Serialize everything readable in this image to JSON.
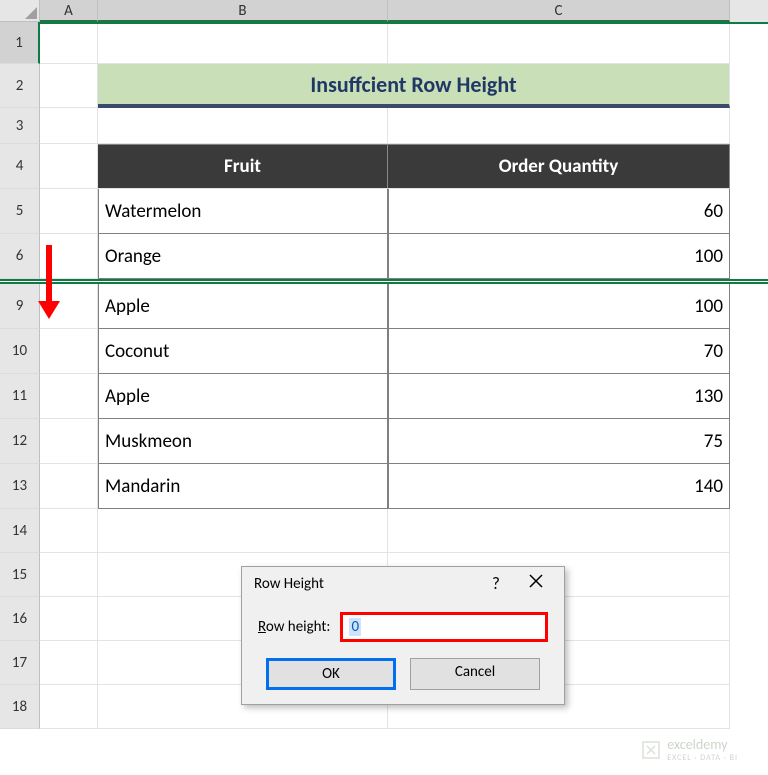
{
  "columns": {
    "A": "A",
    "B": "B",
    "C": "C"
  },
  "rows": {
    "r1": "1",
    "r2": "2",
    "r3": "3",
    "r4": "4",
    "r5": "5",
    "r6": "6",
    "r9": "9",
    "r10": "10",
    "r11": "11",
    "r12": "12",
    "r13": "13",
    "r14": "14",
    "r15": "15",
    "r16": "16",
    "r17": "17",
    "r18": "18"
  },
  "title": "Insuffcient Row Height",
  "headers": {
    "fruit": "Fruit",
    "qty": "Order Quantity"
  },
  "data": [
    {
      "fruit": "Watermelon",
      "qty": "60"
    },
    {
      "fruit": "Orange",
      "qty": "100"
    },
    {
      "fruit": "Apple",
      "qty": "100"
    },
    {
      "fruit": "Coconut",
      "qty": "70"
    },
    {
      "fruit": "Apple",
      "qty": "130"
    },
    {
      "fruit": "Muskmeon",
      "qty": "75"
    },
    {
      "fruit": "Mandarin",
      "qty": "140"
    }
  ],
  "dialog": {
    "title": "Row Height",
    "label_prefix": "R",
    "label_rest": "ow height:",
    "value": "0",
    "ok": "OK",
    "cancel": "Cancel"
  },
  "watermark": {
    "brand": "exceldemy",
    "tag": "EXCEL · DATA · BI"
  },
  "colors": {
    "title_bg": "#c9dfb8",
    "title_underline": "#3b4a6b",
    "title_text": "#203864",
    "thead_bg": "#3a3a3a",
    "excel_green": "#0f7b44",
    "annotation_red": "#ff0000",
    "ok_border_blue": "#0070f0"
  }
}
